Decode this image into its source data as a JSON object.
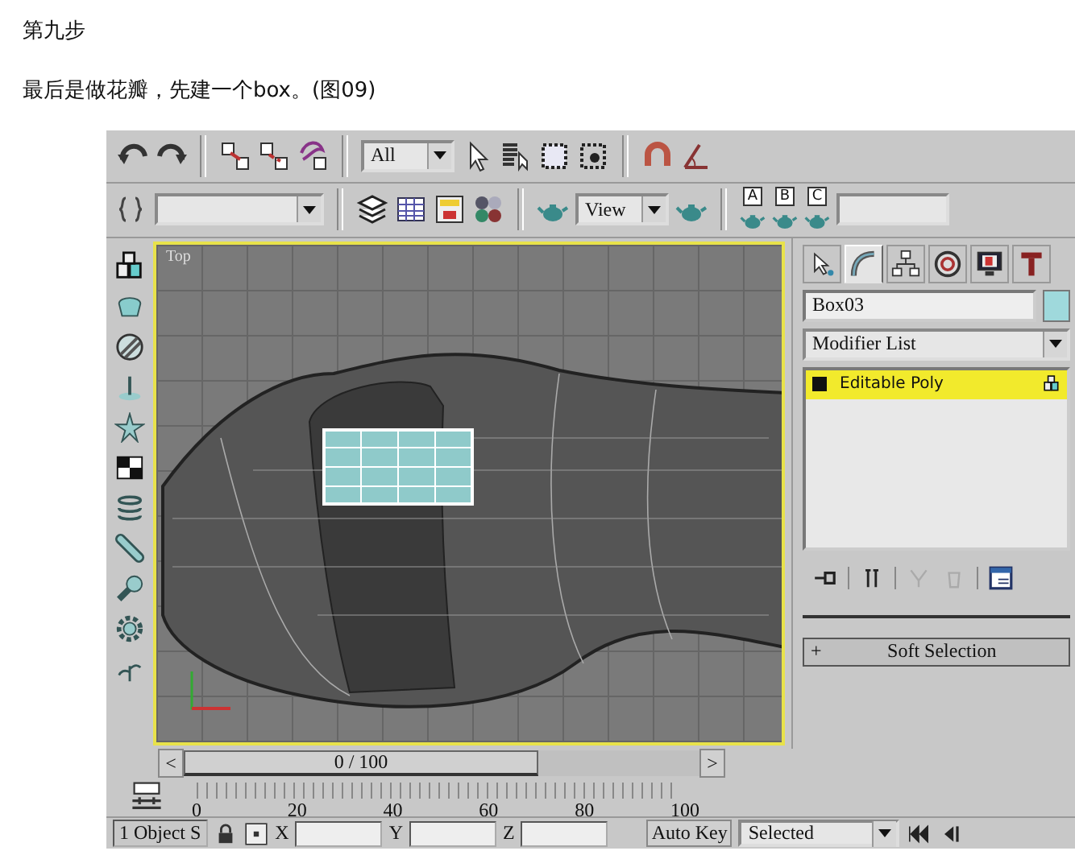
{
  "heading": "第九步",
  "paragraph": "最后是做花瓣，先建一个box。(图09)",
  "app": {
    "toolbar": {
      "selection_filter": "All",
      "view_dropdown": "View",
      "render_buttons": [
        "A",
        "B",
        "C"
      ]
    },
    "viewport": {
      "label": "Top"
    },
    "command_panel": {
      "tabs": [
        {
          "kind": "create",
          "selected": false
        },
        {
          "kind": "modify",
          "selected": true
        },
        {
          "kind": "hierarchy",
          "selected": false
        },
        {
          "kind": "motion",
          "selected": false
        },
        {
          "kind": "display",
          "selected": false
        },
        {
          "kind": "utilities",
          "selected": false
        }
      ],
      "object_name": "Box03",
      "modifier_list": "Modifier List",
      "stack": [
        {
          "label": "Editable Poly",
          "selected": true
        }
      ],
      "rollouts": [
        {
          "sign": "+",
          "label": "Soft Selection"
        }
      ]
    },
    "time_slider": {
      "prev": "<",
      "position": "0 / 100",
      "level": 0,
      "next": ">"
    },
    "ruler": [
      "0",
      "20",
      "40",
      "60",
      "80",
      "100"
    ],
    "status": {
      "selection": "1 Object S",
      "x_label": "X",
      "y_label": "Y",
      "z_label": "Z",
      "auto_key": "Auto Key",
      "key_filter": "Selected"
    }
  }
}
